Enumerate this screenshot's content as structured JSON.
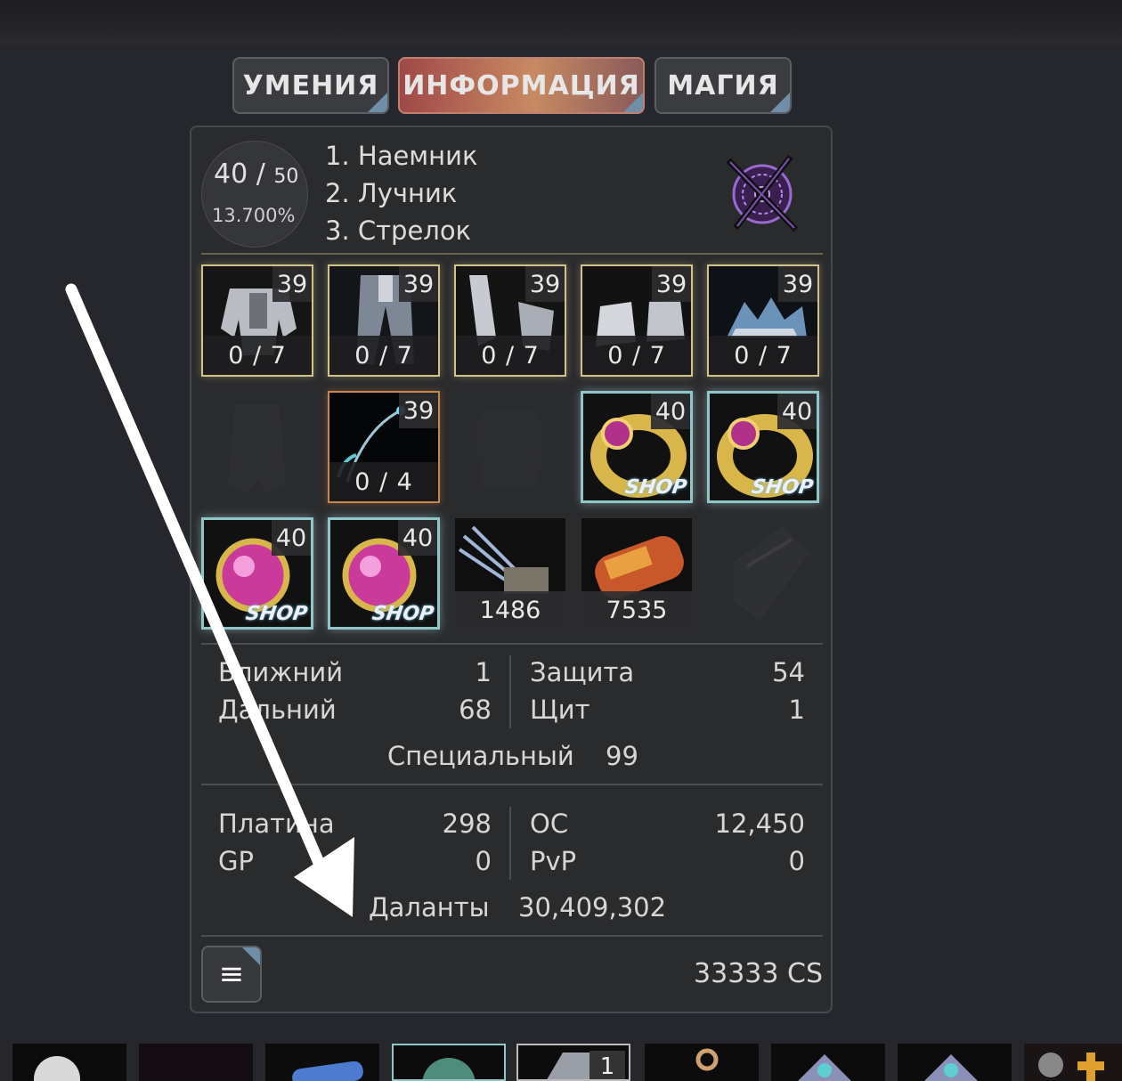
{
  "tabs": [
    {
      "label": "УМЕНИЯ",
      "active": false
    },
    {
      "label": "ИНФОРМАЦИЯ",
      "active": true
    },
    {
      "label": "МАГИЯ",
      "active": false
    }
  ],
  "level": {
    "current": "40 /",
    "max": "50",
    "percent": "13.700%"
  },
  "classes": [
    "1. Наемник",
    "2. Лучник",
    "3. Стрелок"
  ],
  "equipment": {
    "row1": [
      {
        "item": "armor-chest-icon",
        "level": "39",
        "slots": "0 / 7"
      },
      {
        "item": "armor-legs-icon",
        "level": "39",
        "slots": "0 / 7"
      },
      {
        "item": "armor-gloves-icon",
        "level": "39",
        "slots": "0 / 7"
      },
      {
        "item": "armor-boots-icon",
        "level": "39",
        "slots": "0 / 7"
      },
      {
        "item": "armor-helmet-icon",
        "level": "39",
        "slots": "0 / 7"
      }
    ],
    "row2": [
      {
        "item": "empty-cloak-slot-icon"
      },
      {
        "item": "bow-weapon-icon",
        "level": "39",
        "slots": "0 / 4"
      },
      {
        "item": "empty-costume-slot-icon"
      },
      {
        "item": "gold-ring-icon",
        "level": "40",
        "tag": "SHOP"
      },
      {
        "item": "gold-ring-icon",
        "level": "40",
        "tag": "SHOP"
      }
    ],
    "row3": [
      {
        "item": "pink-earring-icon",
        "level": "40",
        "tag": "SHOP"
      },
      {
        "item": "pink-earring-icon",
        "level": "40",
        "tag": "SHOP"
      },
      {
        "item": "arrows-quiver-icon",
        "count": "1486"
      },
      {
        "item": "fuel-canister-icon",
        "count": "7535"
      },
      {
        "item": "empty-bracer-slot-icon"
      }
    ]
  },
  "stats": {
    "melee_label": "Ближний",
    "melee": "1",
    "ranged_label": "Дальний",
    "ranged": "68",
    "defense_label": "Защита",
    "defense": "54",
    "shield_label": "Щит",
    "shield": "1",
    "special_label": "Специальный",
    "special": "99"
  },
  "currency": {
    "platinum_label": "Платина",
    "platinum": "298",
    "gp_label": "GP",
    "gp": "0",
    "oc_label": "ОС",
    "oc": "12,450",
    "pvp_label": "PvP",
    "pvp": "0",
    "dalants_label": "Даланты",
    "dalants": "30,409,302"
  },
  "footer": {
    "menu_icon": "≡",
    "cs": "33333 CS"
  },
  "bottom_bar": {
    "badge": "1"
  },
  "colors": {
    "active_tab": "#c88a62",
    "accent_corner": "#6f8ea8",
    "arrow": "#ffffff"
  }
}
